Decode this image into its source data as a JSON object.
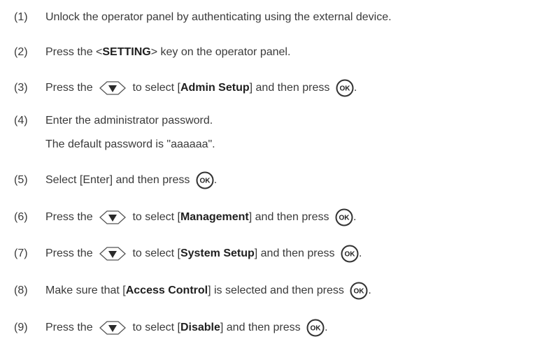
{
  "steps": [
    {
      "num": "(1)",
      "text": "Unlock the operator panel by authenticating using the external device."
    },
    {
      "num": "(2)",
      "pre": "Press the <",
      "bold": "SETTING",
      "post": "> key on the operator panel."
    },
    {
      "num": "(3)",
      "pre": "Press the",
      "mid_pre": "to select [",
      "bold": "Admin Setup",
      "post": "] and then press",
      "end": "."
    },
    {
      "num": "(4)",
      "text": "Enter the administrator password.",
      "note": "The default password is \"aaaaaa\"."
    },
    {
      "num": "(5)",
      "text": "Select [Enter] and then press",
      "end": "."
    },
    {
      "num": "(6)",
      "pre": "Press the",
      "mid_pre": "to select [",
      "bold": "Management",
      "post": "] and then press",
      "end": "."
    },
    {
      "num": "(7)",
      "pre": "Press the",
      "mid_pre": "to select [",
      "bold": "System Setup",
      "post": "] and then press",
      "end": "."
    },
    {
      "num": "(8)",
      "mid_pre": "Make sure that [",
      "bold": "Access Control",
      "post": "] is selected and then press",
      "end": "."
    },
    {
      "num": "(9)",
      "pre": "Press the",
      "mid_pre": "to select [",
      "bold": "Disable",
      "post": "] and then press",
      "end": "."
    }
  ],
  "icons": {
    "down_key": "down-arrow-key-icon",
    "ok_key": "ok-key-icon",
    "ok_key_label": "OK"
  },
  "colors": {
    "text": "#3a3a3a",
    "key_outline": "#555555",
    "arrow_fill": "#2a2a2a"
  }
}
